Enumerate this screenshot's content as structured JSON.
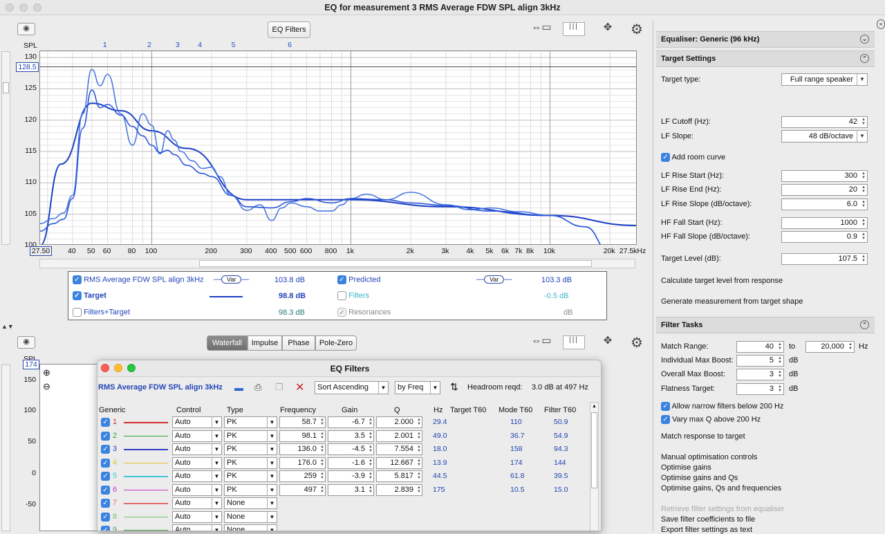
{
  "window": {
    "title": "EQ for measurement 3 RMS Average FDW SPL align 3kHz"
  },
  "toolbar": {
    "eq_filters_label": "EQ Filters"
  },
  "top_graph": {
    "y_axis_title": "SPL",
    "y_ticks": [
      "130",
      "125",
      "120",
      "115",
      "110",
      "105",
      "100"
    ],
    "cursor_value": "128.5",
    "x_ticks": [
      {
        "f": 27.5,
        "l": "27.50"
      },
      {
        "f": 40,
        "l": "40"
      },
      {
        "f": 50,
        "l": "50"
      },
      {
        "f": 60,
        "l": "60"
      },
      {
        "f": 80,
        "l": "80"
      },
      {
        "f": 100,
        "l": "100"
      },
      {
        "f": 200,
        "l": "200"
      },
      {
        "f": 300,
        "l": "300"
      },
      {
        "f": 400,
        "l": "400"
      },
      {
        "f": 500,
        "l": "500"
      },
      {
        "f": 600,
        "l": "600"
      },
      {
        "f": 800,
        "l": "800"
      },
      {
        "f": 1000,
        "l": "1k"
      },
      {
        "f": 2000,
        "l": "2k"
      },
      {
        "f": 3000,
        "l": "3k"
      },
      {
        "f": 4000,
        "l": "4k"
      },
      {
        "f": 5000,
        "l": "5k"
      },
      {
        "f": 6000,
        "l": "6k"
      },
      {
        "f": 7000,
        "l": "7k"
      },
      {
        "f": 8000,
        "l": "8k"
      },
      {
        "f": 10000,
        "l": "10k"
      },
      {
        "f": 20000,
        "l": "20k"
      },
      {
        "f": 27500,
        "l": "27.5kHz"
      }
    ],
    "filter_markers": [
      {
        "f": 58.7,
        "l": "1"
      },
      {
        "f": 98.1,
        "l": "2"
      },
      {
        "f": 136.0,
        "l": "3"
      },
      {
        "f": 176.0,
        "l": "4"
      },
      {
        "f": 259,
        "l": "5"
      },
      {
        "f": 497,
        "l": "6"
      }
    ]
  },
  "chart_data": {
    "type": "line",
    "xlim": [
      27.5,
      27500
    ],
    "ylim": [
      100,
      131
    ],
    "x_scale": "log",
    "grid": true,
    "series": [
      {
        "name": "Target",
        "x": [
          27.5,
          35,
          50,
          70,
          100,
          150,
          300,
          1000,
          3000,
          10000,
          27500
        ],
        "y": [
          100,
          113,
          122.7,
          121.5,
          118.3,
          115.5,
          107.3,
          107.3,
          106.2,
          104.8,
          103.2
        ]
      },
      {
        "name": "RMS Average FDW SPL align 3kHz",
        "x": [
          27.5,
          32,
          36,
          40,
          45,
          50,
          55,
          60,
          70,
          80,
          90,
          100,
          110,
          120,
          130,
          140,
          160,
          180,
          200,
          220,
          250,
          300,
          350,
          400,
          450,
          500,
          600,
          700,
          800,
          900,
          1000,
          1200,
          1500,
          2000,
          3000,
          4000,
          5000,
          7000,
          10000,
          15000,
          20000
        ],
        "y": [
          103.5,
          104.3,
          105.2,
          108,
          121,
          128.1,
          125.5,
          127.3,
          121,
          116,
          121,
          119.2,
          114.6,
          118.3,
          116.8,
          115,
          113.5,
          112.3,
          112.5,
          111,
          108,
          105.6,
          106.5,
          104,
          106,
          106.8,
          106.2,
          105.5,
          105.5,
          106.5,
          107.5,
          108.2,
          107.3,
          108.5,
          106.5,
          105.7,
          106,
          105.4,
          104.8,
          103,
          99
        ]
      },
      {
        "name": "Predicted",
        "x": [
          27.5,
          32,
          36,
          40,
          45,
          50,
          55,
          60,
          70,
          80,
          90,
          100,
          110,
          120,
          130,
          150,
          180,
          200,
          250,
          300,
          400,
          500,
          600,
          800,
          1000,
          1500,
          2000,
          3000,
          5000,
          10000,
          15000,
          20000
        ],
        "y": [
          102.3,
          103.5,
          104.2,
          107.5,
          118.7,
          124.8,
          122,
          122.5,
          120.8,
          119,
          117.5,
          116,
          114.8,
          115.2,
          114.5,
          112.8,
          111.5,
          111,
          108,
          106.2,
          106,
          107,
          107.5,
          106.8,
          107.5,
          107.3,
          106.8,
          106.4,
          105.5,
          104.8,
          103,
          99
        ]
      }
    ]
  },
  "legend": {
    "rows": [
      {
        "name": "RMS Average FDW SPL align 3kHz",
        "var": "Var",
        "value": "103.8 dB"
      },
      {
        "name": "Target",
        "value": "98.8 dB"
      },
      {
        "name": "Filters+Target",
        "value": "98.3 dB"
      }
    ],
    "right": [
      {
        "name": "Predicted",
        "var": "Var",
        "value": "103.3 dB"
      },
      {
        "name": "Filters",
        "value": "-0.5 dB"
      },
      {
        "name": "Resonances",
        "value": "dB"
      }
    ]
  },
  "bottom_graph": {
    "tabs": [
      "Waterfall",
      "Impulse",
      "Phase",
      "Pole-Zero"
    ],
    "y_axis_title": "SPL",
    "cursor_value": "174",
    "y_ticks": [
      "150",
      "100",
      "50",
      "0",
      "-50"
    ]
  },
  "eq_window": {
    "title": "EQ Filters",
    "measurement": "RMS Average FDW SPL align 3kHz",
    "sort": "Sort Ascending",
    "by": "by Freq",
    "headroom_label": "Headroom reqd:",
    "headroom_value": "3.0 dB at 497 Hz",
    "headers": [
      "Generic",
      "Control",
      "Type",
      "Frequency",
      "Gain",
      "Q",
      "Hz",
      "Target T60",
      "Mode T60",
      "Filter T60"
    ],
    "rows": [
      {
        "n": "1",
        "color": "#d22b2b",
        "control": "Auto",
        "type": "PK",
        "freq": "58.7",
        "gain": "-6.7",
        "q": "2.000",
        "hz": "29.4",
        "mode": "110",
        "filt": "50.9"
      },
      {
        "n": "2",
        "color": "#2aa52a",
        "control": "Auto",
        "type": "PK",
        "freq": "98.1",
        "gain": "3.5",
        "q": "2.001",
        "hz": "49.0",
        "mode": "36.7",
        "filt": "54.9"
      },
      {
        "n": "3",
        "color": "#2a3ec7",
        "control": "Auto",
        "type": "PK",
        "freq": "136.0",
        "gain": "-4.5",
        "q": "7.554",
        "hz": "18.0",
        "mode": "158",
        "filt": "94.3"
      },
      {
        "n": "4",
        "color": "#e0c030",
        "control": "Auto",
        "type": "PK",
        "freq": "176.0",
        "gain": "-1.6",
        "q": "12.667",
        "hz": "13.9",
        "mode": "174",
        "filt": "144"
      },
      {
        "n": "5",
        "color": "#3cc7d8",
        "control": "Auto",
        "type": "PK",
        "freq": "259",
        "gain": "-3.9",
        "q": "5.817",
        "hz": "44.5",
        "mode": "61.8",
        "filt": "39.5"
      },
      {
        "n": "6",
        "color": "#c838c8",
        "control": "Auto",
        "type": "PK",
        "freq": "497",
        "gain": "3.1",
        "q": "2.839",
        "hz": "175",
        "mode": "10.5",
        "filt": "15.0"
      },
      {
        "n": "7",
        "color": "#e06a6a",
        "control": "Auto",
        "type": "None"
      },
      {
        "n": "8",
        "color": "#6ac46a",
        "control": "Auto",
        "type": "None"
      },
      {
        "n": "9",
        "color": "#4aa04a",
        "control": "Auto",
        "type": "None"
      }
    ]
  },
  "right_panel": {
    "equaliser_header": "Equaliser: Generic (96 kHz)",
    "target_header": "Target Settings",
    "target_type_label": "Target type:",
    "target_type_value": "Full range speaker",
    "lf_cutoff_label": "LF Cutoff (Hz):",
    "lf_cutoff_value": "42",
    "lf_slope_label": "LF Slope:",
    "lf_slope_value": "48 dB/octave",
    "add_room_curve": "Add room curve",
    "lf_rise_start_label": "LF Rise Start (Hz):",
    "lf_rise_start_value": "300",
    "lf_rise_end_label": "LF Rise End (Hz):",
    "lf_rise_end_value": "20",
    "lf_rise_slope_label": "LF Rise Slope (dB/octave):",
    "lf_rise_slope_value": "6.0",
    "hf_fall_start_label": "HF Fall Start (Hz):",
    "hf_fall_start_value": "1000",
    "hf_fall_slope_label": "HF Fall Slope (dB/octave):",
    "hf_fall_slope_value": "0.9",
    "target_level_label": "Target Level (dB):",
    "target_level_value": "107.5",
    "calc_target": "Calculate target level from response",
    "gen_measurement": "Generate measurement from target shape",
    "filter_tasks_header": "Filter Tasks",
    "match_range_label": "Match Range:",
    "match_range_from": "40",
    "match_range_to_label": "to",
    "match_range_to": "20,000",
    "hz_unit": "Hz",
    "ind_max_boost_label": "Individual Max Boost:",
    "ind_max_boost_value": "5",
    "overall_max_boost_label": "Overall Max Boost:",
    "overall_max_boost_value": "3",
    "flatness_label": "Flatness Target:",
    "flatness_value": "3",
    "db_unit": "dB",
    "allow_narrow": "Allow narrow filters below 200 Hz",
    "vary_max_q": "Vary max Q above 200 Hz",
    "match_response": "Match response to target",
    "manual_opt": "Manual optimisation controls",
    "opt_gains": "Optimise gains",
    "opt_gains_qs": "Optimise gains and Qs",
    "opt_all": "Optimise gains, Qs and frequencies",
    "retrieve": "Retrieve filter settings from equaliser",
    "save_coeff": "Save filter coefficients to file",
    "export": "Export filter settings as text"
  },
  "colors": {
    "measurement": "#4a78e0",
    "target": "#1c3fc4",
    "predicted": "#2a55d8",
    "accent": "#3b83e0"
  }
}
